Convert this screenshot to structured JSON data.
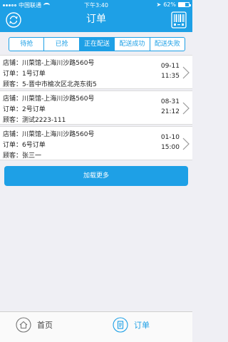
{
  "status_bar": {
    "carrier": "中国联通",
    "time": "下午3:40",
    "battery": "62%"
  },
  "header": {
    "title": "订单"
  },
  "tabs": [
    {
      "label": "待抢"
    },
    {
      "label": "已抢"
    },
    {
      "label": "正在配送",
      "active": true
    },
    {
      "label": "配送成功"
    },
    {
      "label": "配送失败"
    }
  ],
  "orders": [
    {
      "store": "店铺：川菜馆-上海川沙路560号",
      "order": "订单：1号订单",
      "customer": "顾客：5-晋中市榆次区北尧东街5",
      "date": "09-11",
      "time": "11:35"
    },
    {
      "store": "店铺：川菜馆-上海川沙路560号",
      "order": "订单：2号订单",
      "customer": "顾客：测试2223-111",
      "date": "08-31",
      "time": "21:12"
    },
    {
      "store": "店铺：川菜馆-上海川沙路560号",
      "order": "订单：6号订单",
      "customer": "顾客：张三一",
      "date": "01-10",
      "time": "15:00"
    }
  ],
  "load_more": "加载更多",
  "tabbar": {
    "home_label": "首页",
    "orders_label": "订单"
  },
  "colors": {
    "primary": "#1ea0e6"
  }
}
